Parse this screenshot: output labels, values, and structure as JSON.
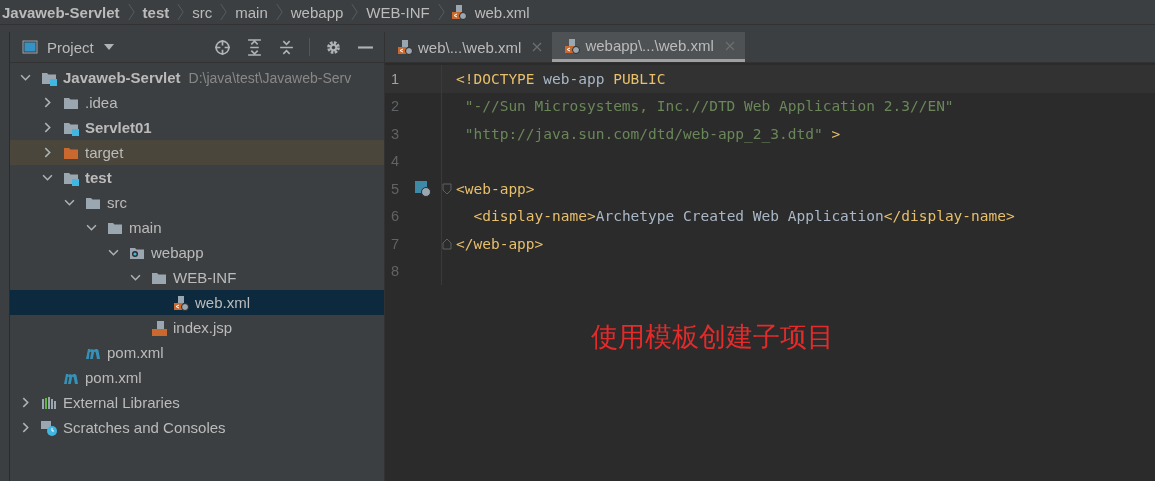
{
  "breadcrumbs": [
    {
      "label": "Javaweb-Servlet",
      "bold": true
    },
    {
      "label": "test",
      "bold": true
    },
    {
      "label": "src",
      "bold": false
    },
    {
      "label": "main",
      "bold": false
    },
    {
      "label": "webapp",
      "bold": false
    },
    {
      "label": "WEB-INF",
      "bold": false
    },
    {
      "label": "web.xml",
      "bold": false,
      "kind": "xml"
    }
  ],
  "project_panel": {
    "title": "Project"
  },
  "tree": [
    {
      "label": "Javaweb-Servlet",
      "path": "D:\\java\\test\\Javaweb-Serv",
      "kind": "module",
      "expanded": true,
      "selected": false,
      "highlighted": false,
      "children": [
        {
          "label": ".idea",
          "kind": "folder",
          "expanded": false,
          "selected": false,
          "highlighted": false
        },
        {
          "label": "Servlet01",
          "kind": "module",
          "expanded": false,
          "selected": false,
          "highlighted": false
        },
        {
          "label": "target",
          "kind": "excluded",
          "expanded": false,
          "selected": false,
          "highlighted": true
        },
        {
          "label": "test",
          "kind": "module",
          "expanded": true,
          "selected": false,
          "highlighted": false,
          "children": [
            {
              "label": "src",
              "kind": "folder",
              "expanded": true,
              "selected": false,
              "highlighted": false,
              "children": [
                {
                  "label": "main",
                  "kind": "folder",
                  "expanded": true,
                  "selected": false,
                  "highlighted": false,
                  "children": [
                    {
                      "label": "webapp",
                      "kind": "webfolder",
                      "expanded": true,
                      "selected": false,
                      "highlighted": false,
                      "children": [
                        {
                          "label": "WEB-INF",
                          "kind": "folder",
                          "expanded": true,
                          "selected": false,
                          "highlighted": false,
                          "children": [
                            {
                              "label": "web.xml",
                              "kind": "xml",
                              "selected": true,
                              "highlighted": false
                            }
                          ]
                        },
                        {
                          "label": "index.jsp",
                          "kind": "jsp",
                          "selected": false,
                          "highlighted": false
                        }
                      ]
                    }
                  ]
                }
              ]
            },
            {
              "label": "pom.xml",
              "kind": "maven",
              "selected": false,
              "highlighted": false
            }
          ]
        },
        {
          "label": "pom.xml",
          "kind": "maven",
          "selected": false,
          "highlighted": false
        }
      ]
    },
    {
      "label": "External Libraries",
      "kind": "libraries",
      "expanded": false,
      "selected": false,
      "highlighted": false
    },
    {
      "label": "Scratches and Consoles",
      "kind": "scratches",
      "expanded": false,
      "selected": false,
      "highlighted": false
    }
  ],
  "tabs": [
    {
      "label": "web\\...\\web.xml",
      "selected": false
    },
    {
      "label": "webapp\\...\\web.xml",
      "selected": true
    }
  ],
  "code_lines": [
    {
      "number": "1",
      "current": true,
      "tokens": [
        {
          "kind": "tag",
          "text": "<!DOCTYPE"
        },
        {
          "kind": "text",
          "text": " web-app "
        },
        {
          "kind": "tag",
          "text": "PUBLIC"
        }
      ]
    },
    {
      "number": "2",
      "current": false,
      "tokens": [
        {
          "kind": "string",
          "text": " \"-//Sun Microsystems, Inc.//DTD Web Application 2.3//EN\""
        }
      ]
    },
    {
      "number": "3",
      "current": false,
      "tokens": [
        {
          "kind": "string",
          "text": " \"http://java.sun.com/dtd/web-app_2_3.dtd\""
        },
        {
          "kind": "tag",
          "text": " >"
        }
      ]
    },
    {
      "number": "4",
      "current": false
    },
    {
      "number": "5",
      "current": false,
      "gutter_icon": true,
      "fold_start": true,
      "tokens": [
        {
          "kind": "tag",
          "text": "<web-app>"
        }
      ]
    },
    {
      "number": "6",
      "current": false,
      "tokens": [
        {
          "kind": "tag",
          "text": "  <display-name>"
        },
        {
          "kind": "text",
          "text": "Archetype Created Web Application"
        },
        {
          "kind": "tag",
          "text": "</display-name>"
        }
      ]
    },
    {
      "number": "7",
      "current": false,
      "fold_end": true,
      "tokens": [
        {
          "kind": "tag",
          "text": "</web-app>"
        }
      ]
    },
    {
      "number": "8",
      "current": false
    }
  ],
  "annotation": "使用模板创建子项目"
}
